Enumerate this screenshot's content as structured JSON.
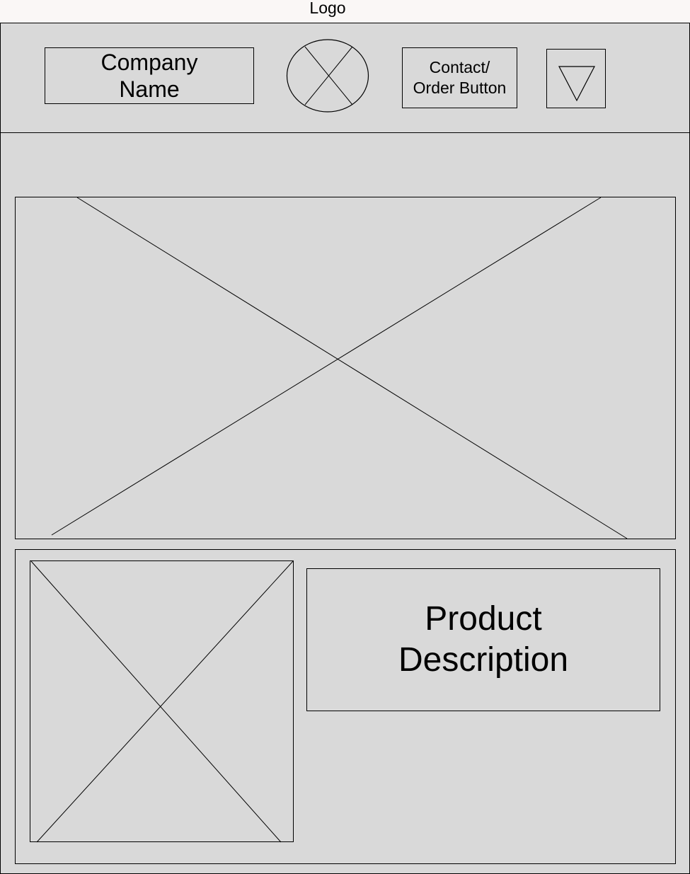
{
  "wireframe": {
    "logo_label": "Logo",
    "header": {
      "company_name": "Company\nName",
      "contact_button_label": "Contact/\nOrder Button",
      "menu_icon": "triangle-down-icon",
      "logo_icon": "image-placeholder-icon"
    },
    "hero": {
      "image_icon": "image-placeholder-icon"
    },
    "product": {
      "image_icon": "image-placeholder-icon",
      "description": "Product\nDescription"
    }
  }
}
